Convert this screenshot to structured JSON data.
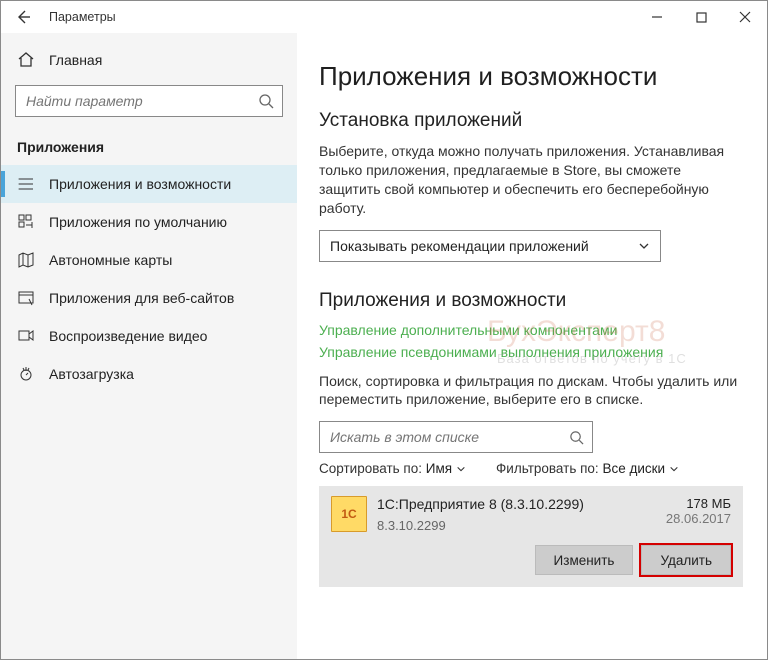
{
  "window": {
    "title": "Параметры"
  },
  "sidebar": {
    "home": "Главная",
    "search_placeholder": "Найти параметр",
    "section": "Приложения",
    "items": [
      {
        "label": "Приложения и возможности"
      },
      {
        "label": "Приложения по умолчанию"
      },
      {
        "label": "Автономные карты"
      },
      {
        "label": "Приложения для веб-сайтов"
      },
      {
        "label": "Воспроизведение видео"
      },
      {
        "label": "Автозагрузка"
      }
    ]
  },
  "main": {
    "page_title": "Приложения и возможности",
    "install_heading": "Установка приложений",
    "install_desc": "Выберите, откуда можно получать приложения. Устанавливая только приложения, предлагаемые в Store, вы сможете защитить свой компьютер и обеспечить его бесперебойную работу.",
    "install_dropdown": "Показывать рекомендации приложений",
    "apps_heading": "Приложения и возможности",
    "link1": "Управление дополнительными компонентами",
    "link2": "Управление псевдонимами выполнения приложения",
    "filter_desc": "Поиск, сортировка и фильтрация по дискам. Чтобы удалить или переместить приложение, выберите его в списке.",
    "app_search_placeholder": "Искать в этом списке",
    "sort_label": "Сортировать по:",
    "sort_value": "Имя",
    "filter_label": "Фильтровать по:",
    "filter_value": "Все диски",
    "app": {
      "name": "1С:Предприятие 8 (8.3.10.2299)",
      "version": "8.3.10.2299",
      "size": "178 МБ",
      "date": "28.06.2017",
      "icon_text": "1С"
    },
    "btn_modify": "Изменить",
    "btn_delete": "Удалить"
  },
  "watermark": {
    "main": "БухЭксперт8",
    "sub": "База ответов по учету в 1С"
  }
}
